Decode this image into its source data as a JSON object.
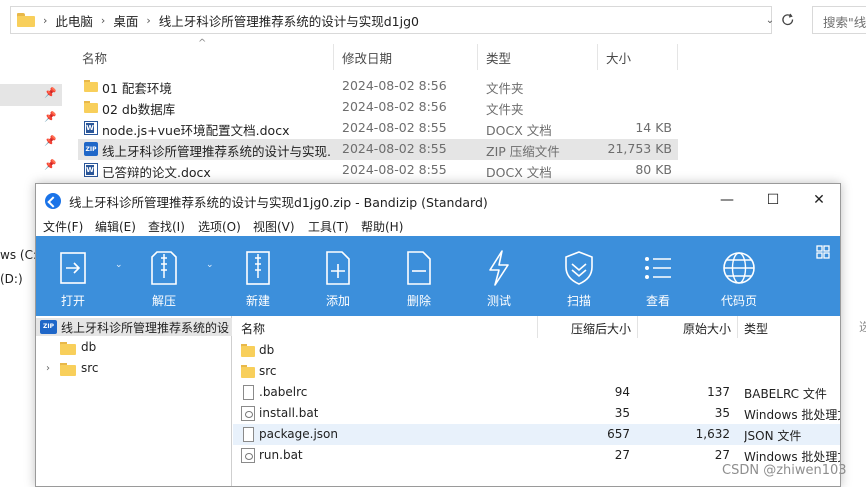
{
  "explorer": {
    "breadcrumb": [
      "此电脑",
      "桌面",
      "线上牙科诊所管理推荐系统的设计与实现d1jg0"
    ],
    "refresh_icon": "refresh-icon",
    "search_placeholder": "搜索\"线上",
    "nav_items": [
      "ws (C:)",
      "(D:)"
    ],
    "columns": [
      "名称",
      "修改日期",
      "类型",
      "大小"
    ],
    "files": [
      {
        "name": "01  配套环境",
        "date": "2024-08-02 8:56",
        "type": "文件夹",
        "size": "",
        "icon": "folder"
      },
      {
        "name": "02 db数据库",
        "date": "2024-08-02 8:56",
        "type": "文件夹",
        "size": "",
        "icon": "folder"
      },
      {
        "name": "node.js+vue环境配置文档.docx",
        "date": "2024-08-02 8:55",
        "type": "DOCX 文档",
        "size": "14 KB",
        "icon": "docx"
      },
      {
        "name": "线上牙科诊所管理推荐系统的设计与实现...",
        "date": "2024-08-02 8:55",
        "type": "ZIP 压缩文件",
        "size": "21,753 KB",
        "icon": "zip"
      },
      {
        "name": "已答辩的论文.docx",
        "date": "2024-08-02 8:55",
        "type": "DOCX 文档",
        "size": "80 KB",
        "icon": "docx"
      }
    ]
  },
  "bandizip": {
    "title": "线上牙科诊所管理推荐系统的设计与实现d1jg0.zip - Bandizip (Standard)",
    "window_controls": [
      "—",
      "☐",
      "✕"
    ],
    "menu": [
      "文件(F)",
      "编辑(E)",
      "查找(I)",
      "选项(O)",
      "视图(V)",
      "工具(T)",
      "帮助(H)"
    ],
    "toolbar": [
      {
        "label": "打开",
        "icon": "open-icon"
      },
      {
        "label": "解压",
        "icon": "extract-icon"
      },
      {
        "label": "新建",
        "icon": "new-archive-icon"
      },
      {
        "label": "添加",
        "icon": "add-file-icon"
      },
      {
        "label": "删除",
        "icon": "delete-file-icon"
      },
      {
        "label": "测试",
        "icon": "test-lightning-icon"
      },
      {
        "label": "扫描",
        "icon": "scan-shield-icon"
      },
      {
        "label": "查看",
        "icon": "view-list-icon"
      },
      {
        "label": "代码页",
        "icon": "codepage-globe-icon"
      }
    ],
    "tree": {
      "root": "线上牙科诊所管理推荐系统的设计",
      "children": [
        "db",
        "src"
      ]
    },
    "list_columns": [
      "名称",
      "压缩后大小",
      "原始大小",
      "类型"
    ],
    "entries": [
      {
        "name": "db",
        "packed": "",
        "original": "",
        "type": "",
        "icon": "folder"
      },
      {
        "name": "src",
        "packed": "",
        "original": "",
        "type": "",
        "icon": "folder"
      },
      {
        "name": ".babelrc",
        "packed": "94",
        "original": "137",
        "type": "BABELRC 文件",
        "icon": "file"
      },
      {
        "name": "install.bat",
        "packed": "35",
        "original": "35",
        "type": "Windows 批处理文",
        "icon": "bat"
      },
      {
        "name": "package.json",
        "packed": "657",
        "original": "1,632",
        "type": "JSON 文件",
        "icon": "file"
      },
      {
        "name": "run.bat",
        "packed": "27",
        "original": "27",
        "type": "Windows 批处理文",
        "icon": "bat"
      }
    ]
  },
  "side_char": "选",
  "watermark": "CSDN @zhiwen103"
}
